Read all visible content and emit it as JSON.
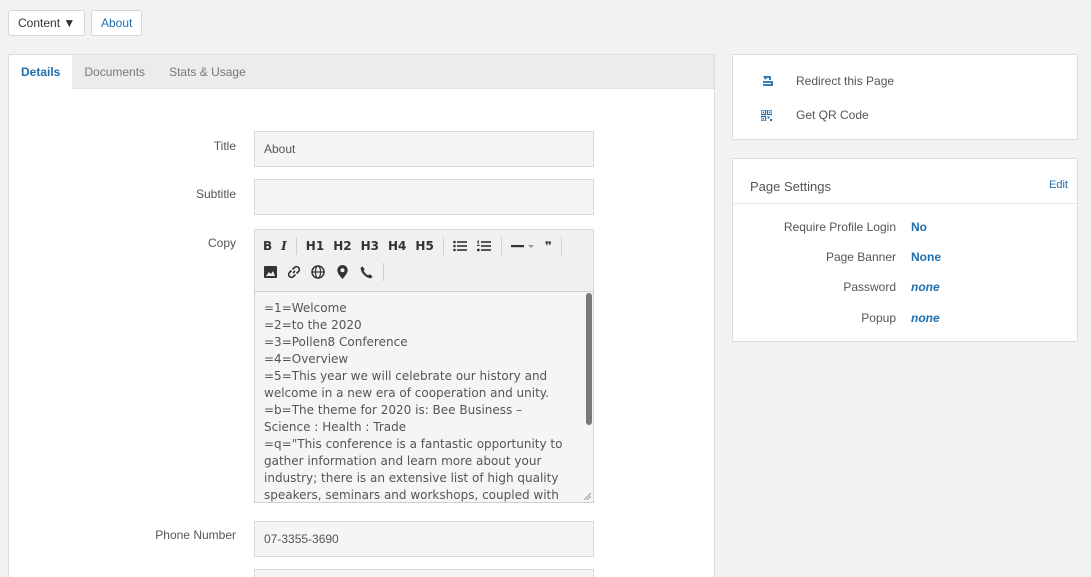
{
  "topbar": {
    "content_label": "Content ▼",
    "about_label": "About"
  },
  "tabs": [
    {
      "label": "Details",
      "active": true
    },
    {
      "label": "Documents",
      "active": false
    },
    {
      "label": "Stats & Usage",
      "active": false
    }
  ],
  "form": {
    "title_label": "Title",
    "title_value": "About",
    "subtitle_label": "Subtitle",
    "subtitle_value": "",
    "copy_label": "Copy",
    "toolbar": {
      "bold": "B",
      "italic": "I",
      "h1": "H1",
      "h2": "H2",
      "h3": "H3",
      "h4": "H4",
      "h5": "H5",
      "quote": "❞"
    },
    "copy_lines": [
      "=1=Welcome",
      "=2=to the 2020",
      "=3=Pollen8 Conference",
      "=4=Overview",
      "=5=This year we will celebrate our history and welcome in a new era of cooperation and unity.",
      "=b=The theme for 2020 is: Bee Business – Science : Health : Trade",
      "=q=\"This conference is a fantastic opportunity to gather information and learn more about your industry; there is an extensive list of high quality speakers, seminars and workshops, coupled with the largest trade exhibition ever"
    ],
    "phone_label": "Phone Number",
    "phone_value": "07-3355-3690"
  },
  "actions": [
    {
      "label": "Redirect this Page",
      "icon": "redirect-icon"
    },
    {
      "label": "Get QR Code",
      "icon": "qr-code-icon"
    }
  ],
  "page_settings": {
    "title": "Page Settings",
    "edit_label": "Edit",
    "rows": [
      {
        "key": "Require Profile Login",
        "value": "No"
      },
      {
        "key": "Page Banner",
        "value": "None"
      },
      {
        "key": "Password",
        "value": "none"
      },
      {
        "key": "Popup",
        "value": "none"
      }
    ]
  },
  "colors": {
    "accent": "#1d6fb0",
    "background": "#f2f2f2",
    "input_bg": "#f5f5f5"
  }
}
